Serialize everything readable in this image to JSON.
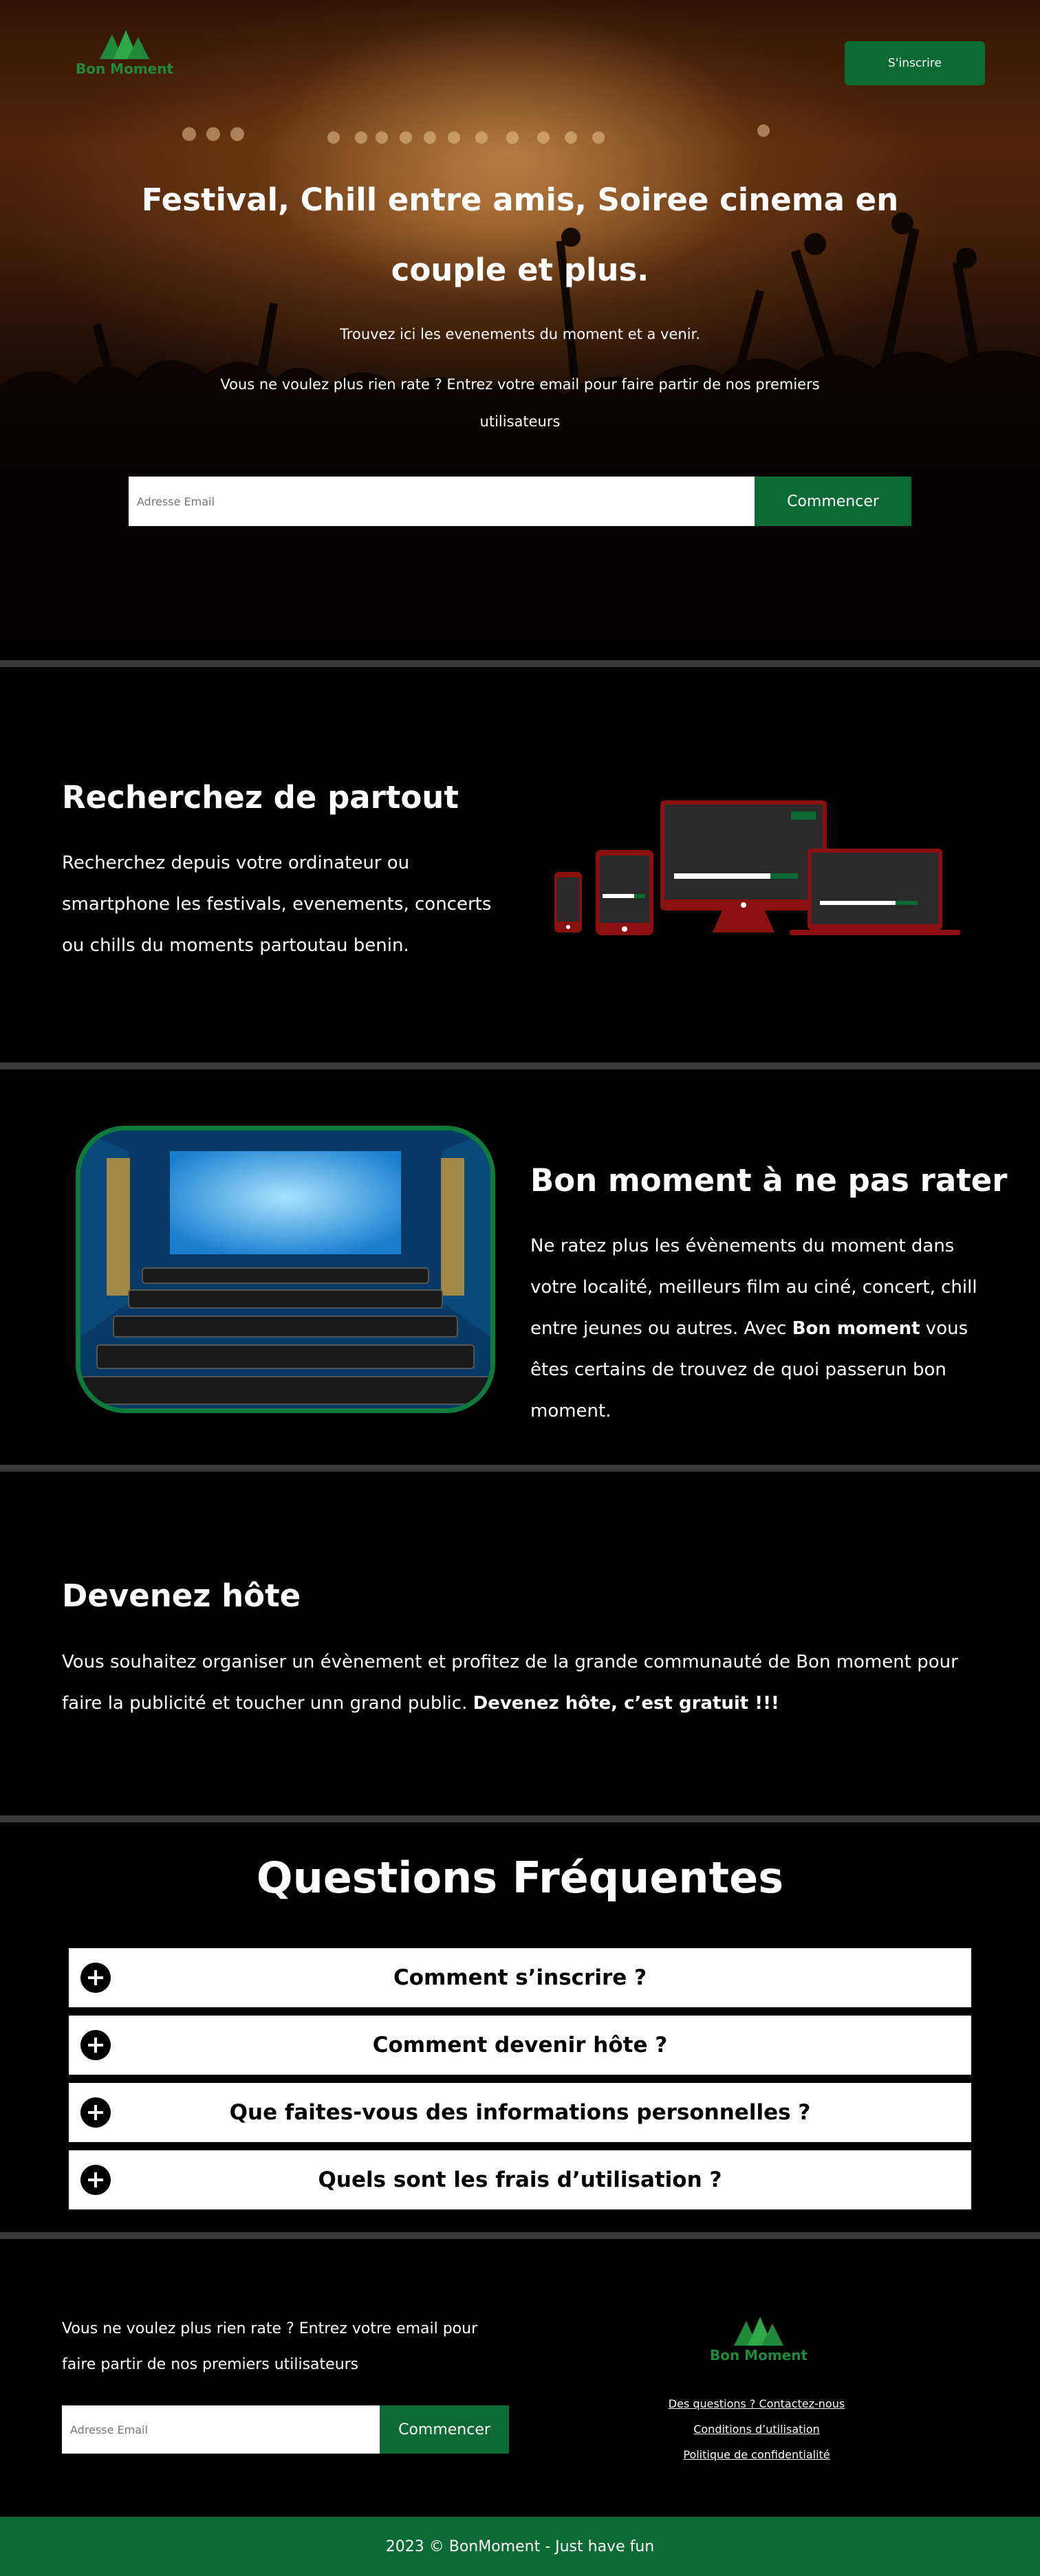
{
  "brand": {
    "name": "Bon Moment",
    "accent": "#0c6b35",
    "logo_green": "#1f8a3a"
  },
  "header": {
    "signup_label": "S'inscrire"
  },
  "hero": {
    "title": "Festival, Chill entre amis, Soiree cinema en couple et plus.",
    "subtitle": "Trouvez ici les evenements du moment et a venir.",
    "cta_text": "Vous ne voulez plus rien rate ? Entrez votre email pour faire partir de nos premiers utilisateurs",
    "email_placeholder": "Adresse Email",
    "start_label": "Commencer"
  },
  "search_section": {
    "title": "Recherchez de partout",
    "text": "Recherchez depuis votre ordinateur ou smartphone les festivals, evenements, concerts ou chills du moments partoutau benin."
  },
  "moment_section": {
    "title": "Bon moment à ne pas rater",
    "text_before": "Ne ratez plus les évènements du moment dans votre localité, meilleurs film au ciné, concert, chill entre jeunes ou autres. Avec ",
    "text_bold": "Bon moment",
    "text_after": " vous êtes certains de trouvez de quoi passerun bon moment."
  },
  "host_section": {
    "title": "Devenez hôte",
    "text_before": "Vous souhaitez organiser un évènement et profitez de la grande communauté de Bon moment pour faire la publicité et toucher unn grand public. ",
    "text_bold": "Devenez hôte, c’est gratuit !!!"
  },
  "faq": {
    "title": "Questions Fréquentes",
    "items": [
      {
        "question": "Comment s’inscrire ?"
      },
      {
        "question": "Comment devenir hôte ?"
      },
      {
        "question": "Que faites-vous des informations personnelles ?"
      },
      {
        "question": "Quels sont les frais d’utilisation ?"
      }
    ]
  },
  "footer": {
    "cta_text": "Vous ne voulez plus rien rate ? Entrez votre email pour faire partir de nos premiers utilisateurs",
    "email_placeholder": "Adresse Email",
    "start_label": "Commencer",
    "links": [
      {
        "label": " Des questions ? Contactez-nous"
      },
      {
        "label": "Conditions d’utilisation"
      },
      {
        "label": "Politique de confidentialité"
      }
    ],
    "copyright": "2023 © BonMoment - Just have fun"
  }
}
